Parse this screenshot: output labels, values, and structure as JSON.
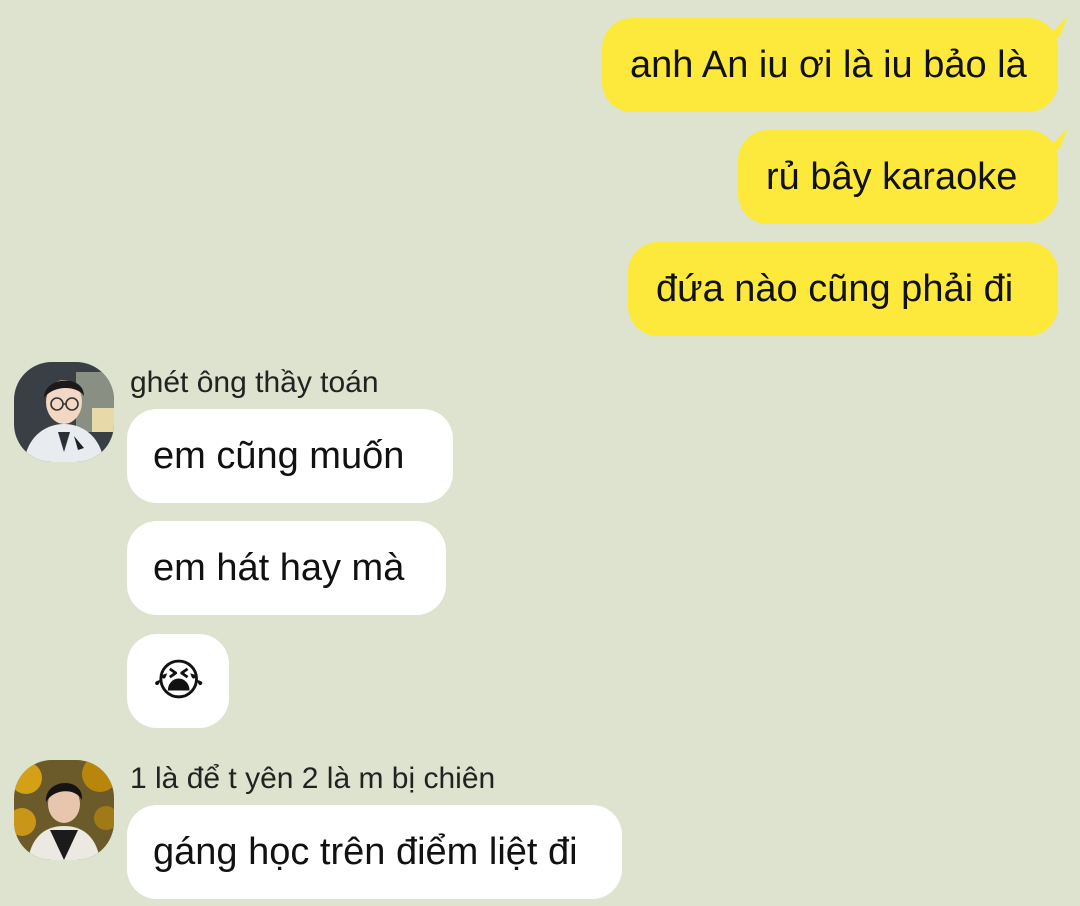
{
  "outgoing": [
    {
      "text": "anh An iu ơi là iu bảo là"
    },
    {
      "text": "rủ bây karaoke"
    },
    {
      "text": "đứa nào cũng phải đi"
    }
  ],
  "groups": [
    {
      "sender": "ghét ông thầy toán",
      "avatar_icon": "user-photo-glasses",
      "messages": [
        "em cũng muốn",
        "em hát hay mà",
        "😭"
      ]
    },
    {
      "sender": "1 là để t yên 2 là m bị chiên",
      "avatar_icon": "user-photo-autumn",
      "messages": [
        "gáng học trên điểm liệt đi"
      ]
    }
  ],
  "colors": {
    "background": "#dde3cf",
    "outgoing_bubble": "#fde93b",
    "incoming_bubble": "#ffffff"
  }
}
